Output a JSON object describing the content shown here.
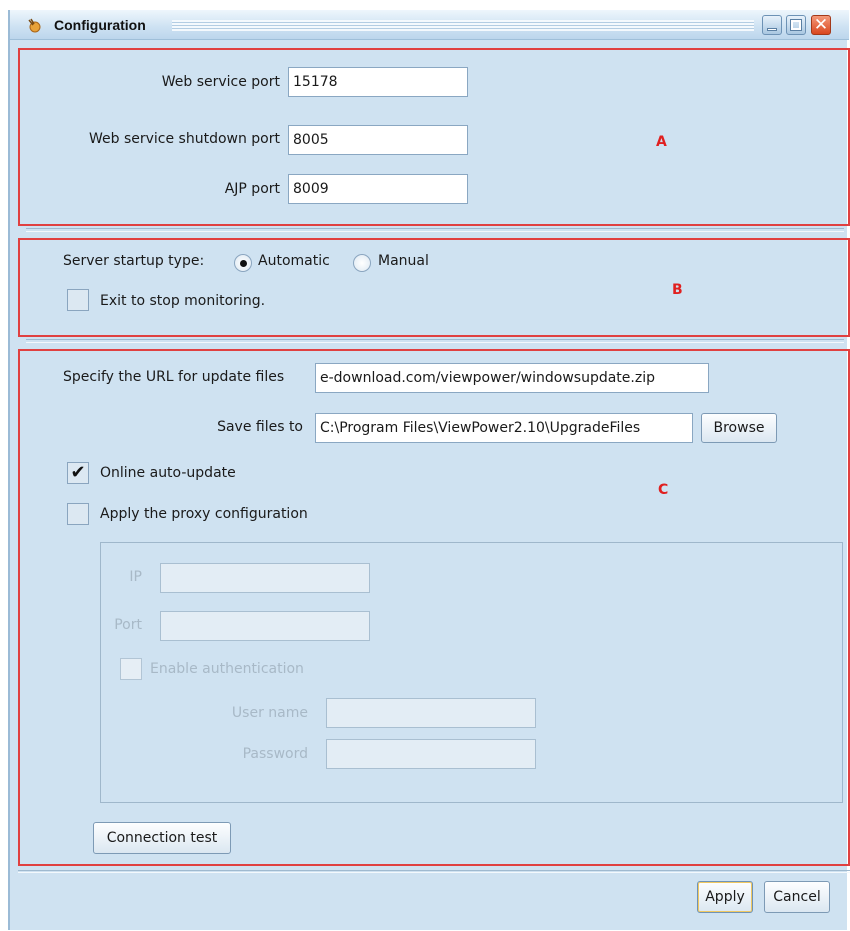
{
  "window": {
    "title": "Configuration"
  },
  "sections": {
    "a": "A",
    "b": "B",
    "c": "C"
  },
  "ports": {
    "web_service_port_label": "Web service port",
    "web_service_port_value": "15178",
    "shutdown_port_label": "Web service shutdown port",
    "shutdown_port_value": "8005",
    "ajp_port_label": "AJP port",
    "ajp_port_value": "8009"
  },
  "startup": {
    "label": "Server startup type:",
    "automatic_label": "Automatic",
    "manual_label": "Manual",
    "selected": "Automatic",
    "exit_label": "Exit to stop monitoring.",
    "exit_checked": false
  },
  "update": {
    "url_label": "Specify the URL for update files",
    "url_value": "e-download.com/viewpower/windowsupdate.zip",
    "save_label": "Save files to",
    "save_value": "C:\\Program Files\\ViewPower2.10\\UpgradeFiles",
    "browse_label": "Browse",
    "online_label": "Online auto-update",
    "online_checked": true,
    "proxy_label": "Apply the proxy configuration",
    "proxy_checked": false
  },
  "proxy": {
    "ip_label": "IP",
    "ip_value": "",
    "port_label": "Port",
    "port_value": "",
    "auth_label": "Enable authentication",
    "auth_checked": false,
    "username_label": "User name",
    "username_value": "",
    "password_label": "Password",
    "password_value": ""
  },
  "buttons": {
    "connection_test": "Connection test",
    "apply": "Apply",
    "cancel": "Cancel"
  },
  "icons": {
    "app": "app-icon",
    "minimize": "minimize-icon",
    "maximize": "maximize-icon",
    "close": "close-icon",
    "checkmark": "✔",
    "close_glyph": "✕"
  },
  "colors": {
    "window_bg": "#cfe2f1",
    "section_border": "#e04040",
    "marker": "#e02020",
    "disabled_text": "#a8b9c7"
  }
}
